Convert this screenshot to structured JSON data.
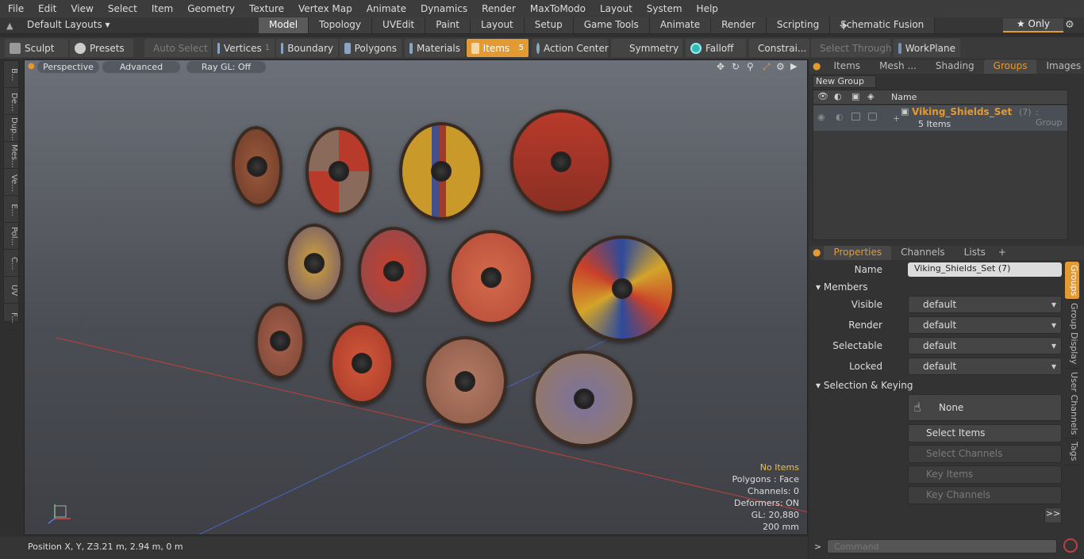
{
  "menu": [
    "File",
    "Edit",
    "View",
    "Select",
    "Item",
    "Geometry",
    "Texture",
    "Vertex Map",
    "Animate",
    "Dynamics",
    "Render",
    "MaxToModo",
    "Layout",
    "System",
    "Help"
  ],
  "layout_selector": "Default Layouts",
  "mode_tabs": [
    {
      "label": "Model",
      "active": true
    },
    {
      "label": "Topology",
      "active": false
    },
    {
      "label": "UVEdit",
      "active": false
    },
    {
      "label": "Paint",
      "active": false
    },
    {
      "label": "Layout",
      "active": false
    },
    {
      "label": "Setup",
      "active": false
    },
    {
      "label": "Game Tools",
      "active": false
    },
    {
      "label": "Animate",
      "active": false
    },
    {
      "label": "Render",
      "active": false
    },
    {
      "label": "Scripting",
      "active": false
    },
    {
      "label": "Schematic Fusion",
      "active": false
    }
  ],
  "only_button": "Only",
  "toolbar": {
    "sculpt": "Sculpt",
    "presets": "Presets",
    "auto_select": "Auto Select",
    "vertices": "Vertices",
    "vertices_count": "1",
    "boundary": "Boundary",
    "polygons": "Polygons",
    "materials": "Materials",
    "items": "Items",
    "items_count": "5",
    "action_center": "Action Center",
    "symmetry": "Symmetry",
    "falloff": "Falloff",
    "constraints": "Constrai...",
    "select_through": "Select Through",
    "workplane": "WorkPlane"
  },
  "left_tools": [
    "B...",
    "De...",
    "Dup...",
    "Mes...",
    "Ve...",
    "E...",
    "Pol...",
    "C...",
    "UV",
    "F..."
  ],
  "viewport": {
    "view_mode": "Perspective",
    "shading": "Advanced",
    "raygl": "Ray GL: Off",
    "info": {
      "selection": "No Items",
      "polygons": "Polygons : Face",
      "channels": "Channels: 0",
      "deformers": "Deformers: ON",
      "gl": "GL: 20,880",
      "scale": "200 mm"
    }
  },
  "status_bar": {
    "label": "Position X, Y, Z:",
    "value": "3.21 m, 2.94 m, 0 m"
  },
  "top_panel": {
    "tabs": [
      {
        "label": "Items",
        "active": false
      },
      {
        "label": "Mesh ...",
        "active": false
      },
      {
        "label": "Shading",
        "active": false
      },
      {
        "label": "Groups",
        "active": true
      },
      {
        "label": "Images",
        "active": false
      }
    ],
    "new_group": "New Group",
    "col_name": "Name",
    "group": {
      "name": "Viking_Shields_Set",
      "count": "(7)",
      "type": ": Group",
      "items": "5 Items"
    }
  },
  "props_panel": {
    "tabs": [
      {
        "label": "Properties",
        "active": true
      },
      {
        "label": "Channels",
        "active": false
      },
      {
        "label": "Lists",
        "active": false
      }
    ],
    "name_label": "Name",
    "name_value": "Viking_Shields_Set (7)",
    "members": "Members",
    "visible_label": "Visible",
    "visible_value": "default",
    "render_label": "Render",
    "render_value": "default",
    "selectable_label": "Selectable",
    "selectable_value": "default",
    "locked_label": "Locked",
    "locked_value": "default",
    "selection_keying": "Selection & Keying",
    "none": "None",
    "select_items": "Select Items",
    "select_channels": "Select Channels",
    "key_items": "Key Items",
    "key_channels": "Key Channels",
    "more": ">>",
    "side_tabs": [
      {
        "label": "Groups",
        "active": true
      },
      {
        "label": "Group Display",
        "active": false
      },
      {
        "label": "User Channels",
        "active": false
      },
      {
        "label": "Tags",
        "active": false
      }
    ]
  },
  "command_placeholder": "Command",
  "colors": {
    "accent": "#e39a33",
    "panel": "#333333",
    "viewport_top": "#6c7078"
  }
}
